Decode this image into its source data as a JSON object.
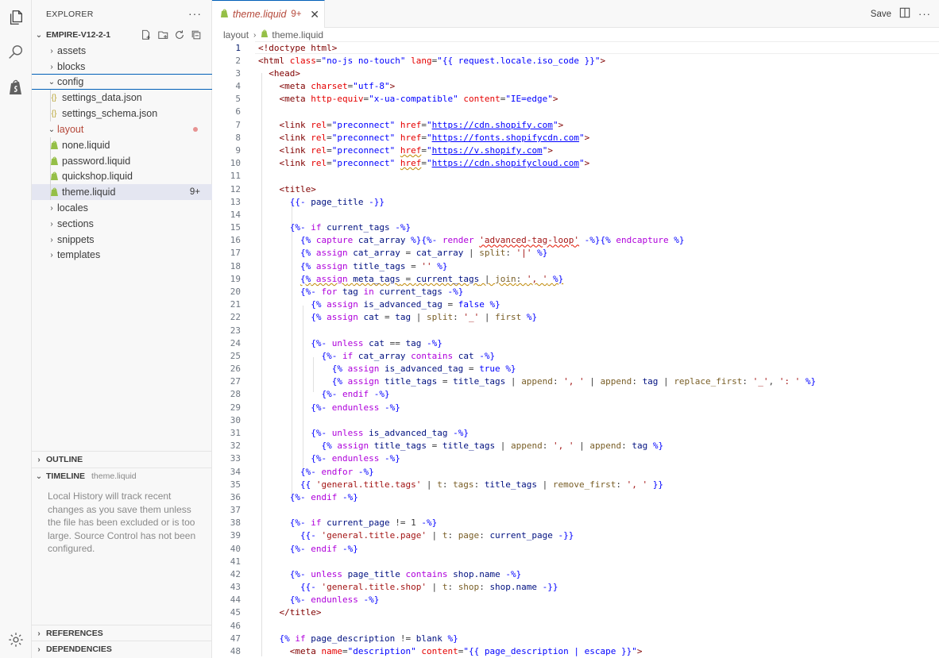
{
  "activity_bar": {
    "icons": [
      "explorer-icon",
      "search-icon",
      "shopify-icon",
      "settings-gear-icon"
    ]
  },
  "sidebar": {
    "title": "EXPLORER",
    "more": "···",
    "project": "EMPIRE-V12-2-1",
    "tree": [
      {
        "label": "assets",
        "type": "folder",
        "expanded": false,
        "depth": 0
      },
      {
        "label": "blocks",
        "type": "folder",
        "expanded": false,
        "depth": 0
      },
      {
        "label": "config",
        "type": "folder",
        "expanded": true,
        "depth": 0
      },
      {
        "label": "settings_data.json",
        "type": "json",
        "depth": 1
      },
      {
        "label": "settings_schema.json",
        "type": "json",
        "depth": 1
      },
      {
        "label": "layout",
        "type": "folder",
        "expanded": true,
        "depth": 0,
        "modified": true
      },
      {
        "label": "none.liquid",
        "type": "liquid",
        "depth": 1
      },
      {
        "label": "password.liquid",
        "type": "liquid",
        "depth": 1
      },
      {
        "label": "quickshop.liquid",
        "type": "liquid",
        "depth": 1
      },
      {
        "label": "theme.liquid",
        "type": "liquid",
        "depth": 1,
        "selected": true,
        "badge": "9+"
      },
      {
        "label": "locales",
        "type": "folder",
        "expanded": false,
        "depth": 0
      },
      {
        "label": "sections",
        "type": "folder",
        "expanded": false,
        "depth": 0
      },
      {
        "label": "snippets",
        "type": "folder",
        "expanded": false,
        "depth": 0
      },
      {
        "label": "templates",
        "type": "folder",
        "expanded": false,
        "depth": 0
      }
    ],
    "outline": "OUTLINE",
    "timeline": "TIMELINE",
    "timeline_file": "theme.liquid",
    "timeline_message": "Local History will track recent changes as you save them unless the file has been excluded or is too large. Source Control has not been configured.",
    "references": "REFERENCES",
    "dependencies": "DEPENDENCIES"
  },
  "editor": {
    "tab": {
      "name": "theme.liquid",
      "count": "9+",
      "close": "✕"
    },
    "save_label": "Save",
    "more": "···",
    "breadcrumb": [
      "layout",
      "theme.liquid"
    ],
    "current_line": 1,
    "lines": [
      "1",
      "2",
      "3",
      "4",
      "5",
      "6",
      "7",
      "8",
      "9",
      "10",
      "11",
      "12",
      "13",
      "14",
      "15",
      "16",
      "17",
      "18",
      "19",
      "20",
      "21",
      "22",
      "23",
      "24",
      "25",
      "26",
      "27",
      "28",
      "29",
      "30",
      "31",
      "32",
      "33",
      "34",
      "35",
      "36",
      "37",
      "38",
      "39",
      "40",
      "41",
      "42",
      "43",
      "44",
      "45",
      "46",
      "47",
      "48"
    ]
  },
  "colors": {
    "accent": "#005fb8",
    "modified": "#b5483a",
    "shopify_green": "#95bf47"
  }
}
